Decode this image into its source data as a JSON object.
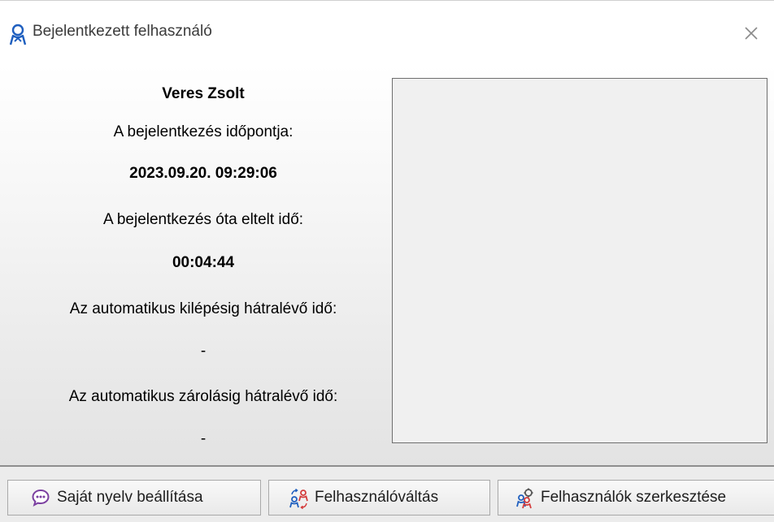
{
  "window": {
    "title": "Bejelentkezett felhasználó",
    "close_symbol": "×"
  },
  "info": {
    "user_name": "Veres Zsolt",
    "login_time_label": "A bejelentkezés időpontja:",
    "login_time_value": "2023.09.20. 09:29:06",
    "elapsed_label": "A bejelentkezés óta eltelt idő:",
    "elapsed_value": "00:04:44",
    "auto_logout_label": "Az automatikus kilépésig hátralévő idő:",
    "auto_logout_value": "-",
    "auto_lock_label": "Az automatikus zárolásig hátralévő idő:",
    "auto_lock_value": "-"
  },
  "buttons": {
    "language": {
      "label": "Saját nyelv beállítása",
      "icon": "speech-bubble-icon"
    },
    "switch_user": {
      "label": "Felhasználóváltás",
      "icon": "switch-user-icon"
    },
    "edit_users": {
      "label": "Felhasználók szerkesztése",
      "icon": "users-settings-icon"
    }
  },
  "colors": {
    "accent_blue": "#1f5fbf",
    "accent_purple": "#7b3fa0",
    "accent_red": "#d43c3c"
  }
}
